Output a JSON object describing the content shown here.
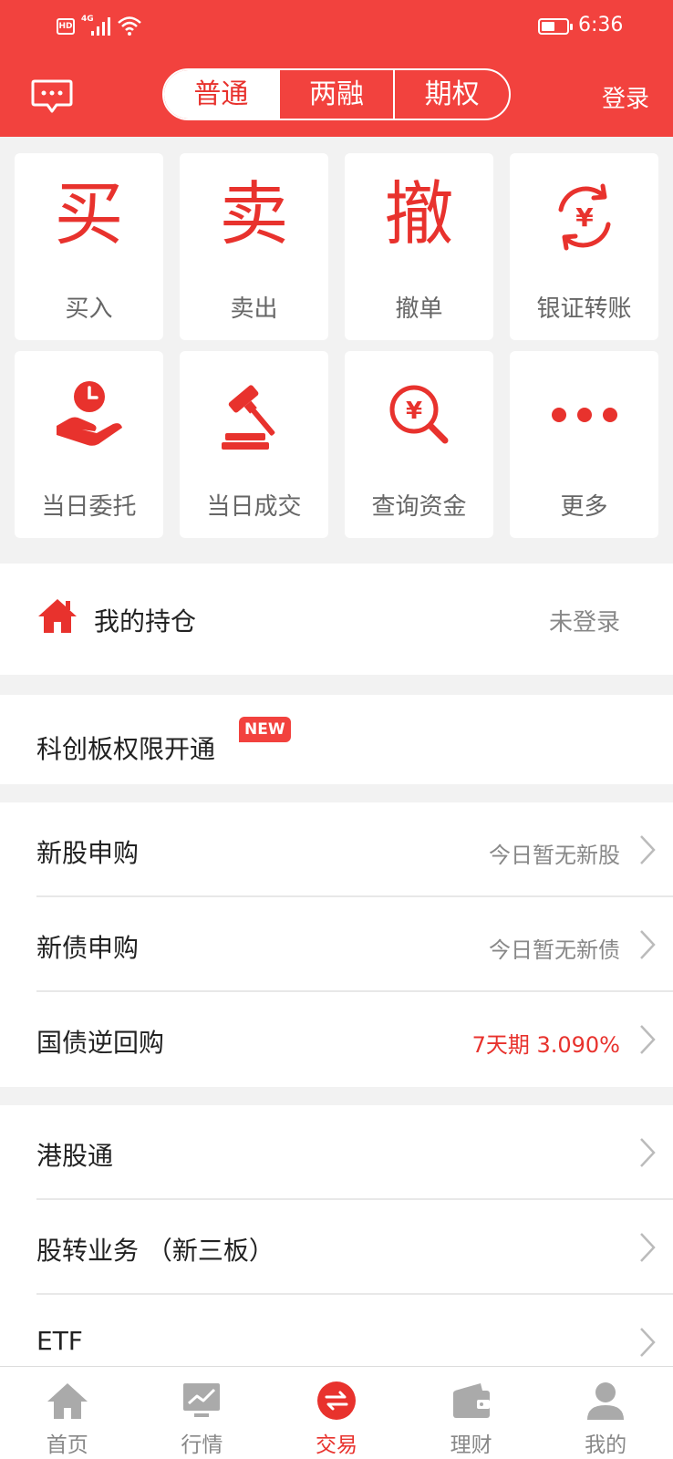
{
  "status_bar": {
    "hd": "HD",
    "network": "4G",
    "time": "6:36"
  },
  "header": {
    "segments": [
      {
        "label": "普通",
        "active": true
      },
      {
        "label": "两融",
        "active": false
      },
      {
        "label": "期权",
        "active": false
      }
    ],
    "login": "登录"
  },
  "quick_actions": [
    {
      "glyph": "买",
      "label": "买入"
    },
    {
      "glyph": "卖",
      "label": "卖出"
    },
    {
      "glyph": "撤",
      "label": "撤单"
    },
    {
      "icon": "yen-exchange-icon",
      "label": "银证转账"
    },
    {
      "icon": "hand-clock-icon",
      "label": "当日委托"
    },
    {
      "icon": "gavel-icon",
      "label": "当日成交"
    },
    {
      "icon": "yen-search-icon",
      "label": "查询资金"
    },
    {
      "icon": "more-dots-icon",
      "label": "更多"
    }
  ],
  "holdings": {
    "title": "我的持仓",
    "status": "未登录"
  },
  "star_market": {
    "title": "科创板权限开通",
    "badge": "NEW"
  },
  "list1": [
    {
      "title": "新股申购",
      "status": "今日暂无新股",
      "highlight": false
    },
    {
      "title": "新债申购",
      "status": "今日暂无新债",
      "highlight": false
    },
    {
      "title": "国债逆回购",
      "status": "7天期 3.090%",
      "highlight": true
    }
  ],
  "list2": [
    {
      "title": "港股通"
    },
    {
      "title": "股转业务 （新三板）"
    },
    {
      "title": "ETF"
    }
  ],
  "tabbar": [
    {
      "label": "首页",
      "icon": "home-icon",
      "active": false
    },
    {
      "label": "行情",
      "icon": "chart-icon",
      "active": false
    },
    {
      "label": "交易",
      "icon": "trade-icon",
      "active": true
    },
    {
      "label": "理财",
      "icon": "wallet-icon",
      "active": false
    },
    {
      "label": "我的",
      "icon": "profile-icon",
      "active": false
    }
  ],
  "colors": {
    "brand_red": "#f2423e",
    "accent_red": "#e8322d",
    "muted": "#888888"
  }
}
